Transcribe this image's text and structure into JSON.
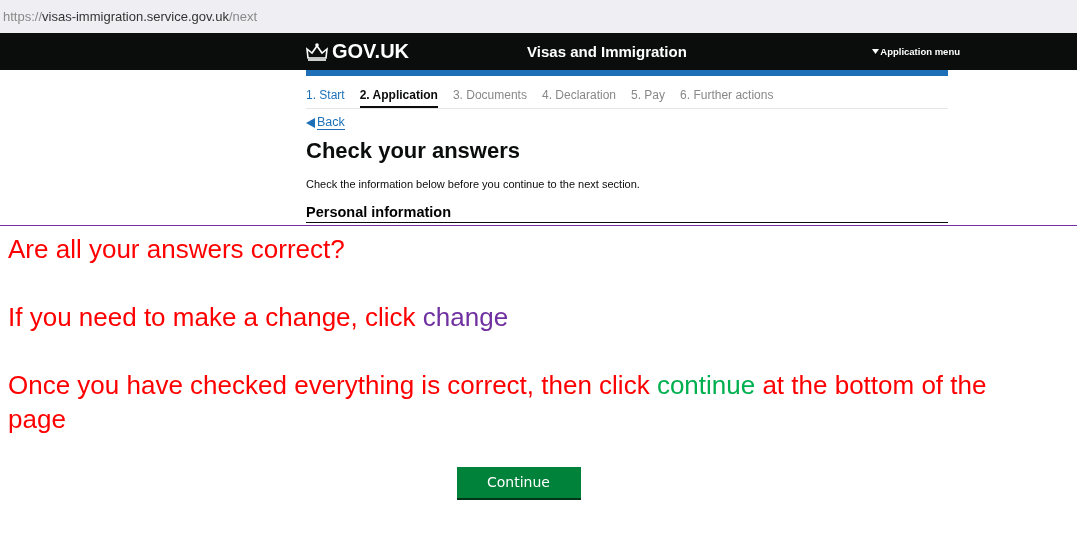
{
  "address_bar": {
    "scheme": "https://",
    "host": "visas-immigration.service.gov.uk",
    "path": "/next"
  },
  "header": {
    "logo": "GOV.UK",
    "service": "Visas and Immigration",
    "menu": "Application menu"
  },
  "steps": [
    {
      "label": "1. Start",
      "selected": false,
      "done": true
    },
    {
      "label": "2. Application",
      "selected": true,
      "done": false
    },
    {
      "label": "3. Documents",
      "selected": false,
      "done": false
    },
    {
      "label": "4. Declaration",
      "selected": false,
      "done": false
    },
    {
      "label": "5. Pay",
      "selected": false,
      "done": false
    },
    {
      "label": "6. Further actions",
      "selected": false,
      "done": false
    }
  ],
  "back_link": "Back",
  "heading": "Check your answers",
  "intro": "Check the information below before you continue to the next section.",
  "section_heading": "Personal information",
  "annotations": [
    [
      {
        "text": "Are all your answers correct?",
        "color": "#ff0000"
      }
    ],
    [
      {
        "text": "If you need to make a change, click ",
        "color": "#ff0000"
      },
      {
        "text": "change",
        "color": "#7030a0"
      }
    ],
    [
      {
        "text": "Once you have checked everything is correct, then click ",
        "color": "#ff0000"
      },
      {
        "text": "continue",
        "color": "#00b050"
      },
      {
        "text": " at the bottom of the page",
        "color": "#ff0000"
      }
    ]
  ],
  "continue_button": "Continue"
}
